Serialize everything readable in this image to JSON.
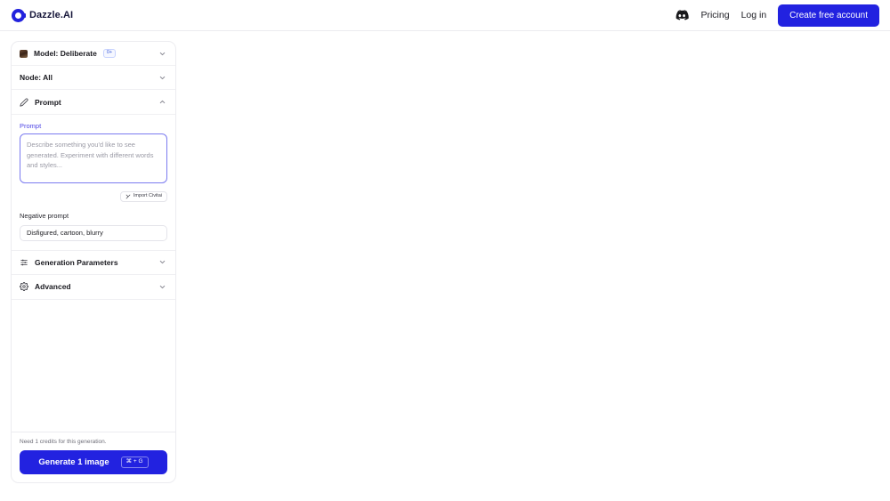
{
  "header": {
    "brand": "Dazzle.AI",
    "brand_icon": "dazzle-logo-icon",
    "discord_icon": "discord-icon",
    "pricing_label": "Pricing",
    "login_label": "Log in",
    "cta_label": "Create free account",
    "accent_color": "#2222e0"
  },
  "panel": {
    "model_row": {
      "label": "Model: Deliberate",
      "badge": "0+",
      "thumb_icon": "model-thumbnail-icon",
      "chevron_icon": "chevron-down-icon"
    },
    "node_row": {
      "label": "Node: All",
      "chevron_icon": "chevron-down-icon"
    },
    "prompt_section": {
      "label": "Prompt",
      "icon": "pencil-icon",
      "chevron_icon": "chevron-up-icon",
      "field_label": "Prompt",
      "placeholder": "Describe something you'd like to see generated. Experiment with different words and styles...",
      "value": "",
      "import_label": "Import Civitai",
      "import_icon": "import-icon"
    },
    "negative_prompt": {
      "label": "Negative prompt",
      "value": "Disfigured, cartoon, blurry",
      "placeholder": "Disfigured, cartoon, blurry"
    },
    "generation_parameters_row": {
      "label": "Generation Parameters",
      "icon": "sliders-icon",
      "chevron_icon": "chevron-down-icon"
    },
    "advanced_row": {
      "label": "Advanced",
      "icon": "gear-icon",
      "chevron_icon": "chevron-down-icon"
    },
    "footer": {
      "credits_note": "Need 1 credits for this generation.",
      "generate_label": "Generate 1 image",
      "shortcut": "⌘ + G"
    }
  }
}
